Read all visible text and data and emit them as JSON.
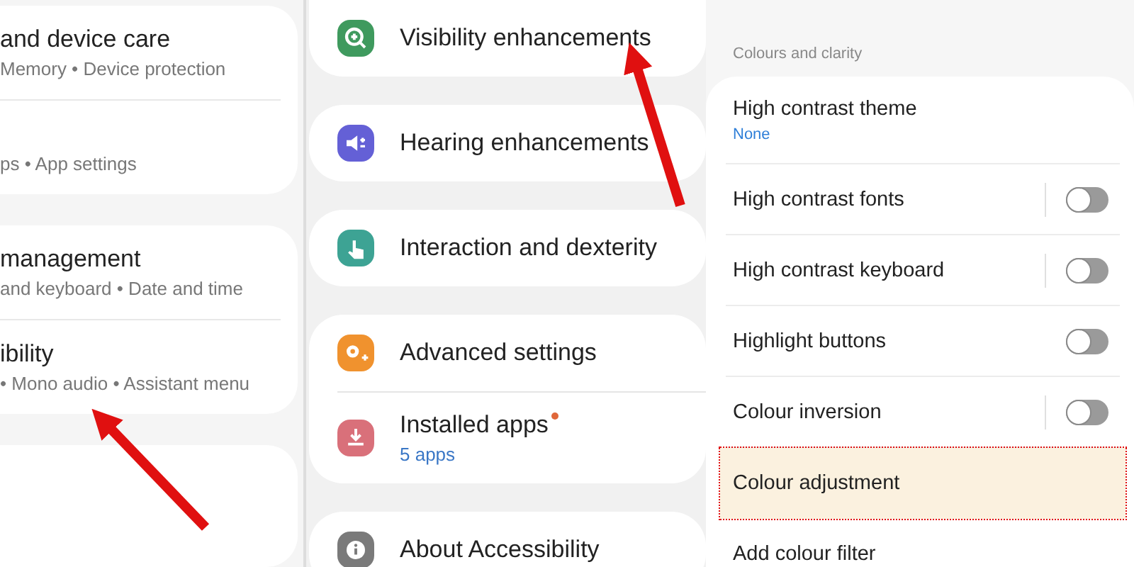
{
  "left_panel": {
    "cards": [
      {
        "rows": [
          {
            "title": "and device care",
            "subtitle": "Memory • Device protection"
          },
          {
            "subtitle": "ps • App settings"
          }
        ]
      },
      {
        "rows": [
          {
            "title": "management",
            "subtitle": "and keyboard • Date and time"
          },
          {
            "title": "ibility",
            "subtitle": "• Mono audio • Assistant menu"
          }
        ]
      }
    ]
  },
  "accessibility_menu": {
    "cards": [
      {
        "items": [
          {
            "label": "Visibility enhancements",
            "color": "#3f9a5e"
          }
        ]
      },
      {
        "items": [
          {
            "label": "Hearing enhancements",
            "color": "#6460d6"
          }
        ]
      },
      {
        "items": [
          {
            "label": "Interaction and dexterity",
            "color": "#3da394"
          }
        ]
      },
      {
        "items": [
          {
            "label": "Advanced settings",
            "color": "#f0922e"
          },
          {
            "label": "Installed apps",
            "color": "#d9707a",
            "subtitle": "5 apps",
            "badge": true
          }
        ]
      },
      {
        "items": [
          {
            "label": "About Accessibility",
            "color": "#7a7a7a"
          }
        ]
      }
    ]
  },
  "colours_and_clarity": {
    "header": "Colours and clarity",
    "rows": [
      {
        "kind": "value",
        "title": "High contrast theme",
        "value": "None",
        "highlighted": false
      },
      {
        "kind": "split_switch",
        "title": "High contrast fonts",
        "on": false,
        "highlighted": false
      },
      {
        "kind": "split_switch",
        "title": "High contrast keyboard",
        "on": false,
        "highlighted": false
      },
      {
        "kind": "switch",
        "title": "Highlight buttons",
        "on": false,
        "highlighted": false
      },
      {
        "kind": "split_switch",
        "title": "Colour inversion",
        "on": false,
        "highlighted": false
      },
      {
        "kind": "plain",
        "title": "Colour adjustment",
        "highlighted": true
      },
      {
        "kind": "plain",
        "title": "Add colour filter",
        "highlighted": false
      }
    ]
  },
  "annotations": [
    {
      "kind": "arrow"
    },
    {
      "kind": "arrow"
    }
  ]
}
